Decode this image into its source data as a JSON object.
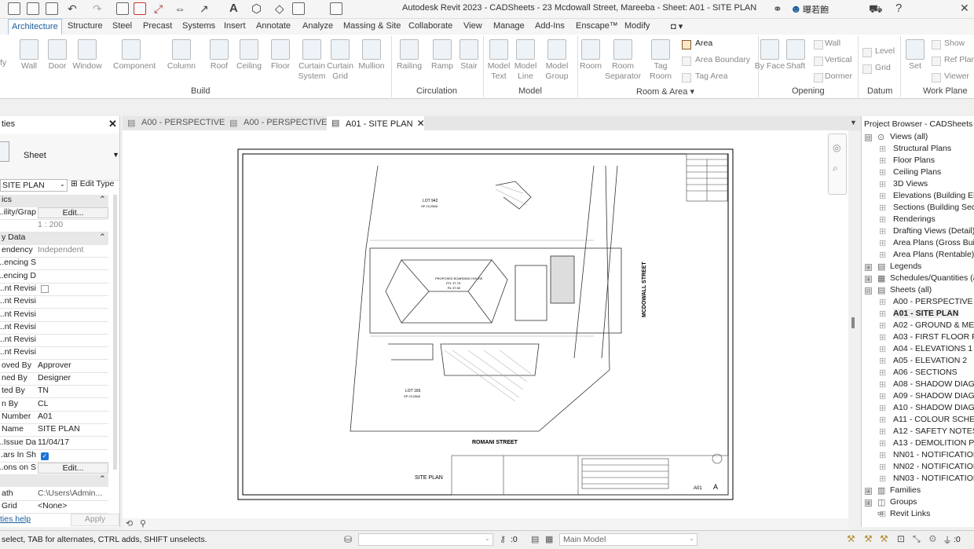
{
  "window": {
    "title": "Autodesk Revit 2023 - CADSheets - 23 Mcdowall Street, Mareeba - Sheet: A01 - SITE PLAN",
    "user": "曝若飽"
  },
  "ribbon_tabs": [
    "Architecture",
    "Structure",
    "Steel",
    "Precast",
    "Systems",
    "Insert",
    "Annotate",
    "Analyze",
    "Massing & Site",
    "Collaborate",
    "View",
    "Manage",
    "Add-Ins",
    "Enscape™",
    "Modify"
  ],
  "ribbon": {
    "build_tools": [
      "Wall",
      "Door",
      "Window",
      "Component",
      "Column",
      "Roof",
      "Ceiling",
      "Floor",
      "Curtain System",
      "Curtain Grid",
      "Mullion"
    ],
    "circulation_tools": [
      "Railing",
      "Ramp",
      "Stair"
    ],
    "model_tools": [
      "Model Text",
      "Model Line",
      "Model Group"
    ],
    "room_tools": [
      "Room",
      "Room Separator",
      "Tag Room"
    ],
    "area_items": [
      "Area",
      "Area Boundary",
      "Tag Area"
    ],
    "opening_tools": [
      "By Face",
      "Shaft"
    ],
    "opening_items": [
      "Wall",
      "Vertical",
      "Dormer"
    ],
    "datum_items": [
      "Level",
      "Grid"
    ],
    "workplane_tools": [
      "Set"
    ],
    "workplane_items": [
      "Show",
      "Ref Plane",
      "Viewer"
    ],
    "groups": [
      "Build",
      "Circulation",
      "Model",
      "Room & Area",
      "Opening",
      "Datum",
      "Work Plane"
    ],
    "left_edge_label": "fy"
  },
  "properties": {
    "title": "ties",
    "type_name": "Sheet",
    "selector_value": "SITE PLAN",
    "edit_type": "Edit Type",
    "section_graphics": "ics",
    "vis_label": "ility/Grap...",
    "vis_value": "Edit...",
    "scale_value": "1 : 200",
    "section_identity": "y Data",
    "rows": [
      {
        "k": "endency",
        "v": "Independent"
      },
      {
        "k": "encing S...",
        "v": ""
      },
      {
        "k": "encing D...",
        "v": ""
      },
      {
        "k": "nt Revisi...",
        "v": ""
      },
      {
        "k": "nt Revisi...",
        "v": ""
      },
      {
        "k": "nt Revisi...",
        "v": ""
      },
      {
        "k": "nt Revisi...",
        "v": ""
      },
      {
        "k": "nt Revisi...",
        "v": ""
      },
      {
        "k": "nt Revisi...",
        "v": ""
      },
      {
        "k": "oved By",
        "v": "Approver"
      },
      {
        "k": "ned By",
        "v": "Designer"
      },
      {
        "k": "ted By",
        "v": "TN"
      },
      {
        "k": "n By",
        "v": "CL"
      },
      {
        "k": "Number",
        "v": "A01"
      },
      {
        "k": "Name",
        "v": "SITE PLAN"
      },
      {
        "k": "Issue Da...",
        "v": "11/04/17"
      },
      {
        "k": "ars In Sh...",
        "v": ""
      },
      {
        "k": "ons on S...",
        "v": "Edit..."
      }
    ],
    "path_label": "ath",
    "path_value": "C:\\Users\\Admin...",
    "grid_label": "Grid",
    "grid_value": "<None>",
    "help_link": "ties help",
    "apply": "Apply"
  },
  "doc_tabs": [
    "A00 - PERSPECTIVE",
    "A00 - PERSPECTIVE",
    "A01 - SITE PLAN"
  ],
  "drawing": {
    "lot_top": "LOT 942",
    "lot_top_area": "SP 23,2568",
    "lot_bottom": "LOT 165",
    "lot_bottom_area": "SP 23,2568",
    "house_label": "PROPOSED BOARDING HOUSE",
    "house_ffl": "FFL 37.75",
    "house_rl": "RL 37.60",
    "street_right": "MCDOWALL STREET",
    "street_bottom": "ROMANI STREET",
    "view_title": "SITE PLAN",
    "sheet_number": "A01",
    "revision": "A"
  },
  "project_browser": {
    "title": "Project Browser - CADSheets - 2",
    "views_root": "Views (all)",
    "views": [
      "Structural Plans",
      "Floor Plans",
      "Ceiling Plans",
      "3D Views",
      "Elevations (Building El",
      "Sections (Building Sect",
      "Renderings",
      "Drafting Views (Detail)",
      "Area Plans (Gross Build",
      "Area Plans (Rentable)"
    ],
    "legends": "Legends",
    "schedules": "Schedules/Quantities (a",
    "sheets_root": "Sheets (all)",
    "sheets": [
      "A00 - PERSPECTIVE",
      "A01 - SITE PLAN",
      "A02 - GROUND & MEZ",
      "A03 - FIRST FLOOR PLA",
      "A04 - ELEVATIONS 1",
      "A05 - ELEVATION 2",
      "A06 - SECTIONS",
      "A08 - SHADOW DIAGR",
      "A09 - SHADOW DIAGR",
      "A10 - SHADOW DIAGR",
      "A11 - COLOUR SCHEDU",
      "A12 - SAFETY NOTES",
      "A13 - DEMOLITION PLA",
      "NN01 - NOTIFICATION",
      "NN02 - NOTIFICATION",
      "NN03 - NOTIFICATION"
    ],
    "families": "Families",
    "groups": "Groups",
    "revit_links": "Revit Links"
  },
  "status": {
    "hint": "select, TAB for alternates, CTRL adds, SHIFT unselects.",
    "count": ":0",
    "model": "Main Model",
    "filter_count": ":0"
  },
  "colors": {
    "accent": "#1a5d9c",
    "tab_border": "#9cc3e6",
    "checkbox": "#1e73d8"
  }
}
